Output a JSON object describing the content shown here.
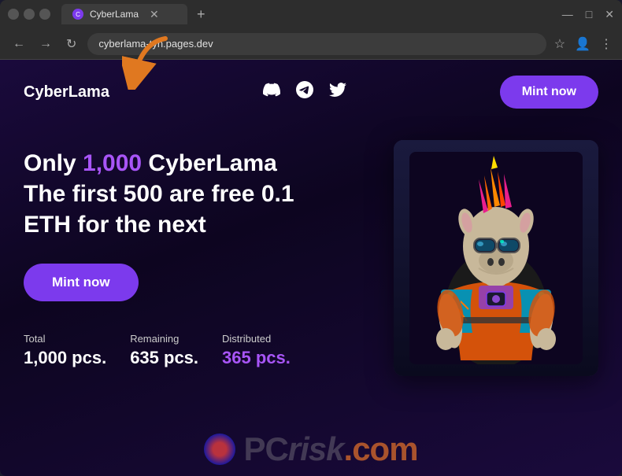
{
  "browser": {
    "tab_title": "CyberLama",
    "tab_favicon": "C",
    "address": "cyberlama-tyn.pages.dev",
    "new_tab_label": "+",
    "nav_back": "←",
    "nav_forward": "→",
    "nav_reload": "↻",
    "window_minimize": "—",
    "window_maximize": "□",
    "window_close": "✕"
  },
  "site": {
    "logo": "CyberLama",
    "nav_icons": {
      "discord": "⊞",
      "telegram": "✈",
      "twitter": "🐦"
    },
    "mint_button_nav": "Mint now",
    "mint_button_hero": "Mint now",
    "hero_title_part1": "Only ",
    "hero_title_highlight": "1,000",
    "hero_title_part2": " CyberLama",
    "hero_title_line2": "The first 500 are free 0.1",
    "hero_title_line3": "ETH for the next",
    "stats": [
      {
        "label": "Total",
        "value": "1,000 pcs.",
        "color": "white"
      },
      {
        "label": "Remaining",
        "value": "635 pcs.",
        "color": "white"
      },
      {
        "label": "Distributed",
        "value": "365 pcs.",
        "color": "purple"
      }
    ]
  },
  "watermark": {
    "text_pc": "PC",
    "text_risk": "risk",
    "text_com": ".com"
  },
  "colors": {
    "accent": "#7c3aed",
    "highlight": "#a855f7",
    "bg_dark": "#0d0520",
    "bg_gradient_start": "#1a0a3c"
  }
}
